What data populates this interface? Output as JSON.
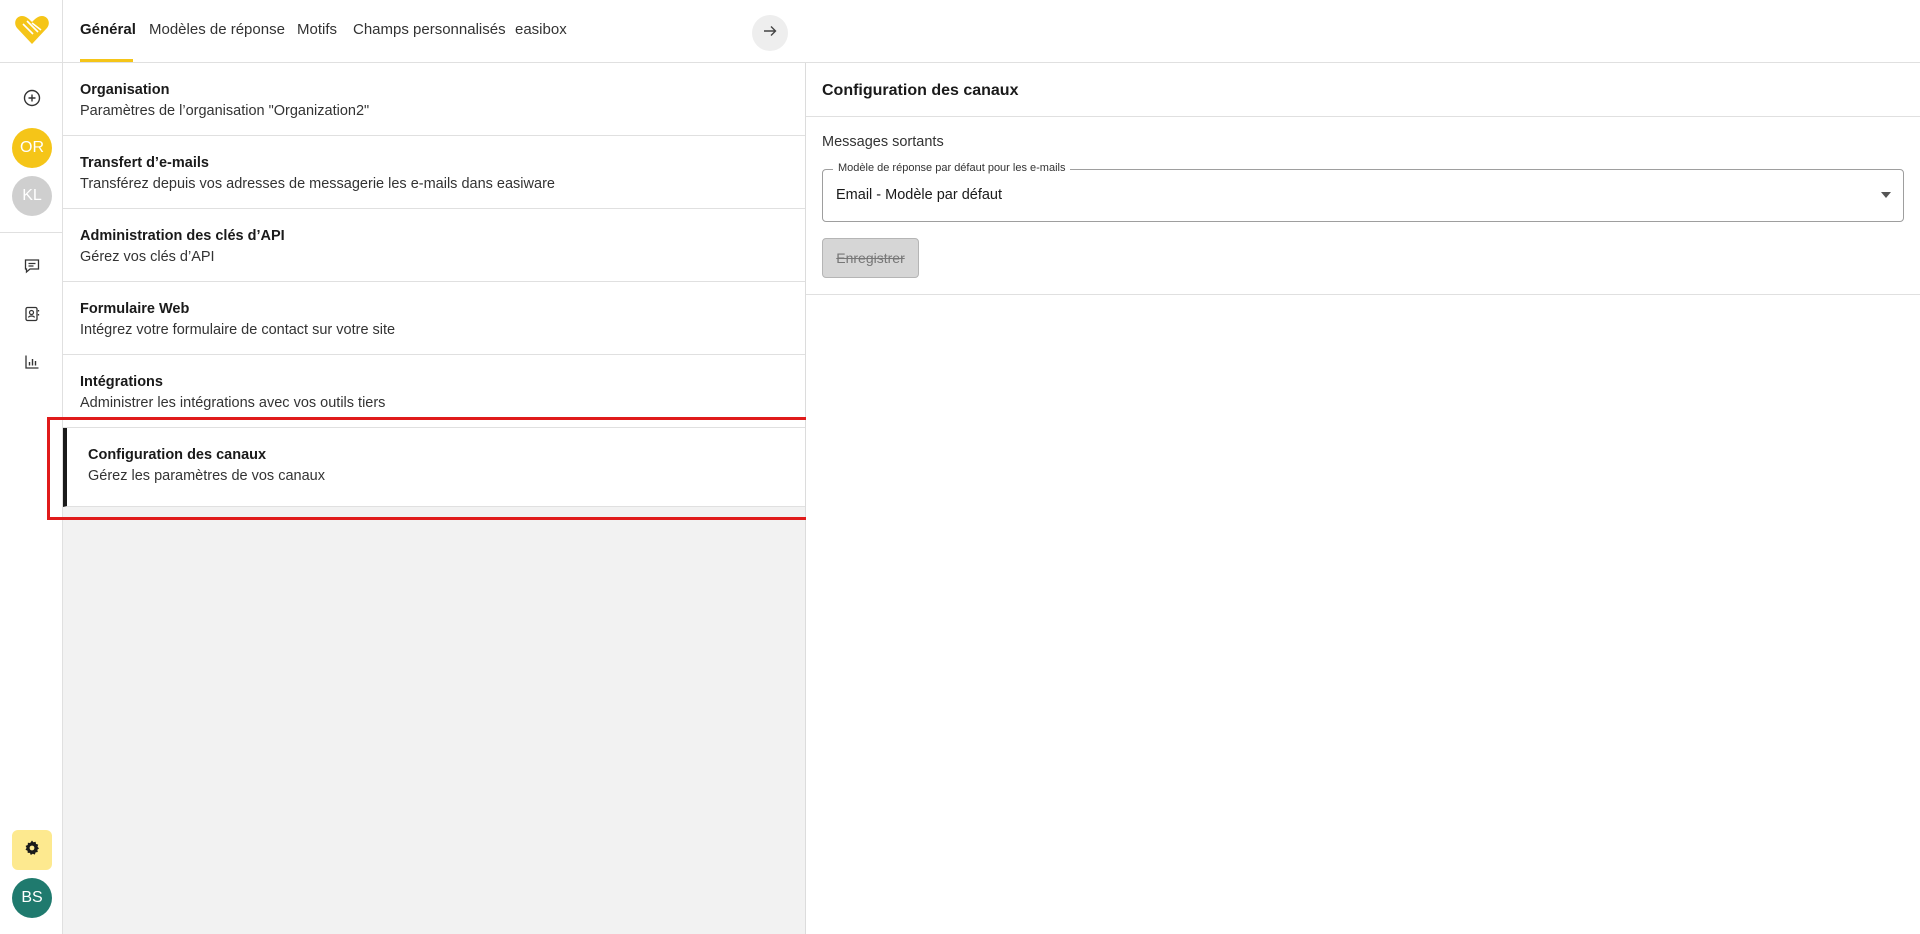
{
  "rail": {
    "logo_icon": "heart-logo-icon",
    "new_icon": "plus-circle-icon",
    "avatars": [
      {
        "initials": "OR",
        "color": "#f5c518"
      },
      {
        "initials": "KL",
        "color": "#cfcfcf"
      }
    ],
    "nav_icons": [
      "chat-icon",
      "contacts-icon",
      "analytics-icon"
    ],
    "settings_icon": "gear-icon",
    "user": {
      "initials": "BS",
      "color": "#1f7a6e"
    }
  },
  "tabs": [
    {
      "label": "Général",
      "active": true
    },
    {
      "label": "Modèles de réponse",
      "active": false
    },
    {
      "label": "Motifs",
      "active": false
    },
    {
      "label": "Champs personnalisés",
      "active": false
    },
    {
      "label": "easibox",
      "active": false
    }
  ],
  "settings_items": [
    {
      "title": "Organisation",
      "desc": "Paramètres de l’organisation \"Organization2\""
    },
    {
      "title": "Transfert d’e-mails",
      "desc": "Transférez depuis vos adresses de messagerie les e-mails dans easiware"
    },
    {
      "title": "Administration des clés d’API",
      "desc": "Gérez vos clés d’API"
    },
    {
      "title": "Formulaire Web",
      "desc": "Intégrez votre formulaire de contact sur votre site"
    },
    {
      "title": "Intégrations",
      "desc": "Administrer les intégrations avec vos outils tiers"
    },
    {
      "title": "Configuration des canaux",
      "desc": "Gérez les paramètres de vos canaux",
      "selected": true
    }
  ],
  "detail": {
    "title": "Configuration des canaux",
    "section": "Messages sortants",
    "select_label": "Modèle de réponse par défaut pour les e-mails",
    "select_value": "Email - Modèle par défaut",
    "save_label": "Enregistrer"
  },
  "colors": {
    "accent": "#f5c518",
    "highlight": "#e01b1b"
  }
}
